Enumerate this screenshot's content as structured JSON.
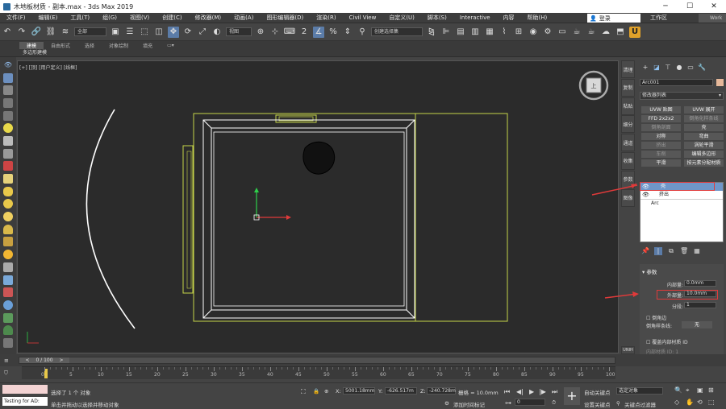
{
  "window": {
    "title": "木地板材质 - 副本.max - 3ds Max 2019",
    "minimize": "─",
    "maximize": "☐",
    "close": "✕"
  },
  "menu": {
    "items": [
      "文件(F)",
      "编辑(E)",
      "工具(T)",
      "组(G)",
      "视图(V)",
      "创建(C)",
      "修改器(M)",
      "动画(A)",
      "图形编辑器(D)",
      "渲染(R)",
      "Civil View",
      "自定义(U)",
      "脚本(S)",
      "Interactive",
      "内容",
      "帮助(H)"
    ],
    "login": "登录",
    "workspace_label": "工作区",
    "workspace_value": "Work"
  },
  "toolbar": {
    "filter": "全部",
    "coord": "视图",
    "named_sel": "创建选择集"
  },
  "ribbon": {
    "tabs": [
      "建模",
      "自由形式",
      "选择",
      "对象绘制",
      "填充"
    ],
    "sub": "多边形建模"
  },
  "viewport": {
    "label": "[+] [顶] [用户定义] [线框]"
  },
  "viewcube_label": "上",
  "side_tabs": [
    "清理",
    "复制",
    "粘贴",
    "细分",
    "通道",
    "收集",
    "参数",
    "图像"
  ],
  "side_tab_unit": "UNIH",
  "command_panel": {
    "object_name": "Arc001",
    "modifier_list": "修改器列表",
    "modifier_buttons": [
      {
        "label": "UVW 贴图",
        "dim": false
      },
      {
        "label": "UVW 展开",
        "dim": false
      },
      {
        "label": "FFD 2x2x2",
        "dim": false
      },
      {
        "label": "倒角化样条线",
        "dim": true
      },
      {
        "label": "倒角剖面",
        "dim": true
      },
      {
        "label": "壳",
        "dim": false
      },
      {
        "label": "对称",
        "dim": false
      },
      {
        "label": "弯曲",
        "dim": false
      },
      {
        "label": "挤出",
        "dim": true
      },
      {
        "label": "涡轮平滑",
        "dim": false
      },
      {
        "label": "车削",
        "dim": true
      },
      {
        "label": "编辑多边形",
        "dim": false
      },
      {
        "label": "平滑",
        "dim": false
      },
      {
        "label": "按元素分配材质",
        "dim": false
      }
    ],
    "stack": [
      {
        "label": "壳",
        "selected": true,
        "eye": true
      },
      {
        "label": "挤出",
        "selected": false,
        "eye": true
      },
      {
        "label": "Arc",
        "selected": false,
        "eye": false
      }
    ],
    "params": {
      "header": "参数",
      "inner_label": "内部量:",
      "inner_value": "0.0mm",
      "outer_label": "外部量:",
      "outer_value": "10.0mm",
      "segments_label": "分段:",
      "segments_value": "1",
      "bevel_edges": "倒角边",
      "bevel_spline_label": "倒角样条线:",
      "bevel_spline_value": "无",
      "override_inner": "覆盖内部材质 ID",
      "inner_mat": "内部材质 ID: 1"
    }
  },
  "timeline": {
    "frame": "0 / 100",
    "ticks": [
      "0",
      "5",
      "10",
      "15",
      "20",
      "25",
      "30",
      "35",
      "40",
      "45",
      "50",
      "55",
      "60",
      "65",
      "70",
      "75",
      "80",
      "85",
      "90",
      "95",
      "100"
    ]
  },
  "status": {
    "script_label": "Testing for AD:",
    "selected": "选择了 1 个 对象",
    "hint": "单击并拖动以选择并移动对象",
    "x": "5001.18mm",
    "y": "-626.517m",
    "z": "-240.728m",
    "grid": "栅格 = 10.0mm",
    "add_time_tag": "添加时间标记",
    "auto_key": "自动关键点",
    "set_key": "设置关键点",
    "selected_obj": "选定对象",
    "key_filter": "关键点过滤器",
    "frame_value": "0"
  }
}
